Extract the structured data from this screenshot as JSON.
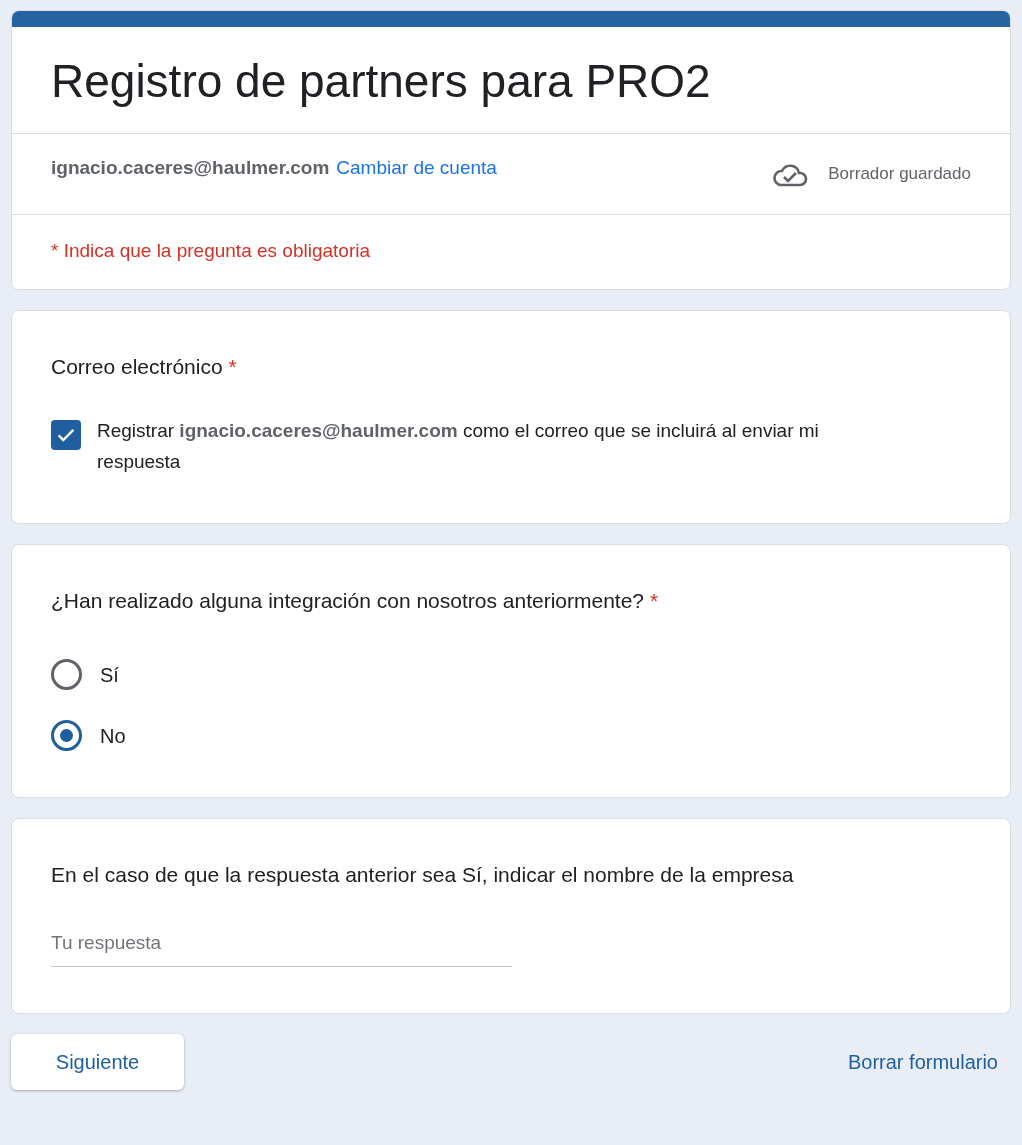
{
  "form": {
    "title": "Registro de partners para PRO2",
    "account": {
      "email": "ignacio.caceres@haulmer.com",
      "switch_link": "Cambiar de cuenta",
      "status": "Borrador guardado"
    },
    "required_note": "* Indica que la pregunta es obligatoria"
  },
  "questions": [
    {
      "kind": "email",
      "title": "Correo electrónico",
      "required_mark": "*",
      "checkbox": {
        "label": "Registrar **ignacio.caceres@haulmer.com** como el correo que se incluirá al enviar mi respuesta",
        "checked": true
      }
    },
    {
      "kind": "radio",
      "title": "¿Han realizado alguna integración con nosotros anteriormente?",
      "required_mark": "*",
      "options": [
        {
          "label": "Sí",
          "selected": false
        },
        {
          "label": "No",
          "selected": true
        }
      ]
    },
    {
      "kind": "text",
      "title": "En el caso de que la respuesta anterior sea Sí, indicar el nombre de la empresa",
      "placeholder": "Tu respuesta"
    }
  ],
  "footer": {
    "next_button": "Siguiente",
    "clear_link": "Borrar formulario"
  }
}
